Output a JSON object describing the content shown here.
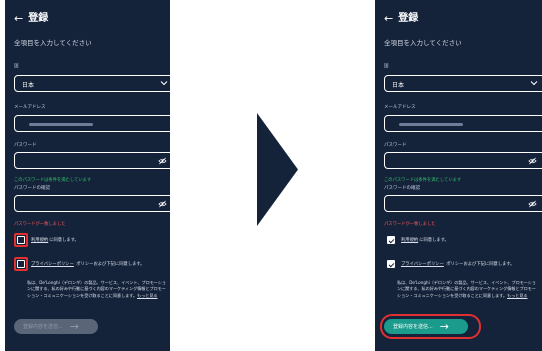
{
  "colors": {
    "accent": "#1a9b8b",
    "highlight": "#e0302f",
    "background": "#14223a",
    "valid": "#35c36a",
    "error": "#ff5a5f"
  },
  "header": {
    "back_icon": "←",
    "title": "登録"
  },
  "subtitle": "全項目を入力してください",
  "country": {
    "label": "国",
    "value": "日本"
  },
  "email": {
    "label": "メールアドレス"
  },
  "password": {
    "label": "パスワード",
    "valid_message": "このパスワードは条件を満たしています"
  },
  "password_confirm": {
    "label": "パスワードの確認",
    "match_message": "パスワードが一致しました"
  },
  "terms": {
    "link": "利用規約",
    "suffix": "に同意します。"
  },
  "privacy": {
    "link": "プライバシーポリシー",
    "suffix": " ポリシーおよび下記に同意します。"
  },
  "marketing": {
    "text": "私は、De'Longhi（デロンギ）の製品、サービス、イベント、プロモーションに関する、私の好みや行動に基づく内容のマーケティング情報とプロモーション・コミュニケーションを受け取ることに同意します。",
    "more": "もっと見る"
  },
  "submit": {
    "label": "登録内容を送信...",
    "arrow": "→"
  },
  "states": {
    "before": {
      "terms_checked": false,
      "privacy_checked": false,
      "submit_enabled": false
    },
    "after": {
      "terms_checked": true,
      "privacy_checked": true,
      "submit_enabled": true
    }
  }
}
